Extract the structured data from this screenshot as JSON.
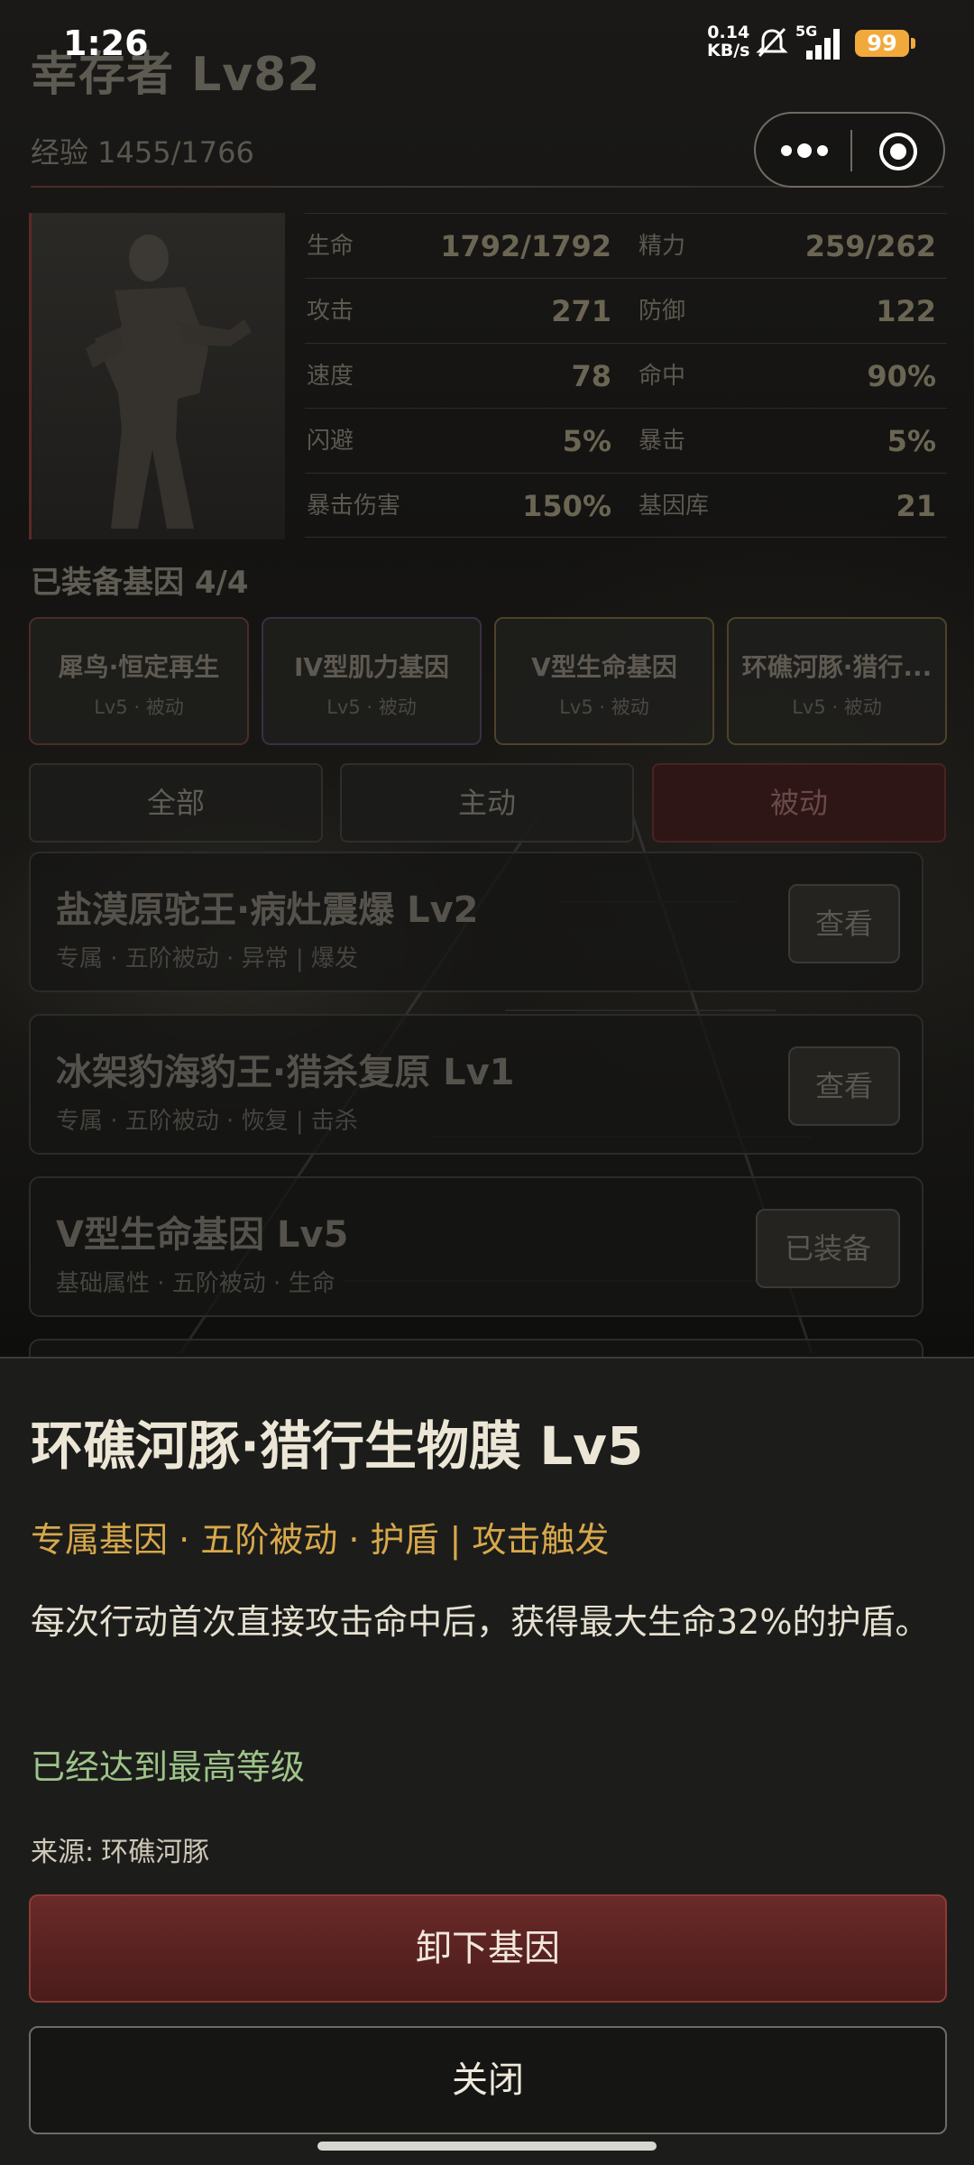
{
  "status_bar": {
    "time": "1:26",
    "net_speed": "0.14",
    "net_unit": "KB/s",
    "network": "5G",
    "battery": "99",
    "icons": [
      "mute-icon",
      "signal-icon",
      "battery-icon"
    ]
  },
  "header": {
    "title": "幸存者 Lv82",
    "exp": "经验 1455/1766"
  },
  "capsule": {
    "icons": [
      "more-dots-icon",
      "target-icon"
    ]
  },
  "stats": {
    "rows": [
      [
        {
          "label": "生命",
          "value": "1792/1792"
        },
        {
          "label": "精力",
          "value": "259/262"
        }
      ],
      [
        {
          "label": "攻击",
          "value": "271"
        },
        {
          "label": "防御",
          "value": "122"
        }
      ],
      [
        {
          "label": "速度",
          "value": "78"
        },
        {
          "label": "命中",
          "value": "90%"
        }
      ],
      [
        {
          "label": "闪避",
          "value": "5%"
        },
        {
          "label": "暴击",
          "value": "5%"
        }
      ],
      [
        {
          "label": "暴击伤害",
          "value": "150%"
        },
        {
          "label": "基因库",
          "value": "21"
        }
      ]
    ]
  },
  "equipped": {
    "title": "已装备基因 4/4",
    "slots": [
      {
        "name": "犀鸟·恒定再生",
        "sub": "Lv5 · 被动"
      },
      {
        "name": "IV型肌力基因",
        "sub": "Lv5 · 被动"
      },
      {
        "name": "V型生命基因",
        "sub": "Lv5 · 被动"
      },
      {
        "name": "环礁河豚·猎行...",
        "sub": "Lv5 · 被动"
      }
    ]
  },
  "filters": {
    "all": "全部",
    "active": "主动",
    "passive": "被动",
    "selected": "被动"
  },
  "gene_list": [
    {
      "name": "盐漠原驼王·病灶震爆 Lv2",
      "tags": "专属 · 五阶被动 · 异常 | 爆发",
      "button": "查看"
    },
    {
      "name": "冰架豹海豹王·猎杀复原 Lv1",
      "tags": "专属 · 五阶被动 · 恢复 | 击杀",
      "button": "查看"
    },
    {
      "name": "V型生命基因 Lv5",
      "tags": "基础属性 · 五阶被动 · 生命",
      "button": "已装备"
    }
  ],
  "sheet": {
    "title": "环礁河豚·猎行生物膜 Lv5",
    "tags": "专属基因 · 五阶被动 · 护盾 | 攻击触发",
    "description": "每次行动首次直接攻击命中后，获得最大生命32%的护盾。",
    "max_level": "已经达到最高等级",
    "source_label": "来源:",
    "source_value": "环礁河豚",
    "unequip_button": "卸下基因",
    "close_button": "关闭"
  },
  "colors": {
    "accent_gold": "#d8a84a",
    "max_green": "#9ec48a",
    "danger_red": "#6a2a28",
    "battery": "#f2a93b"
  }
}
